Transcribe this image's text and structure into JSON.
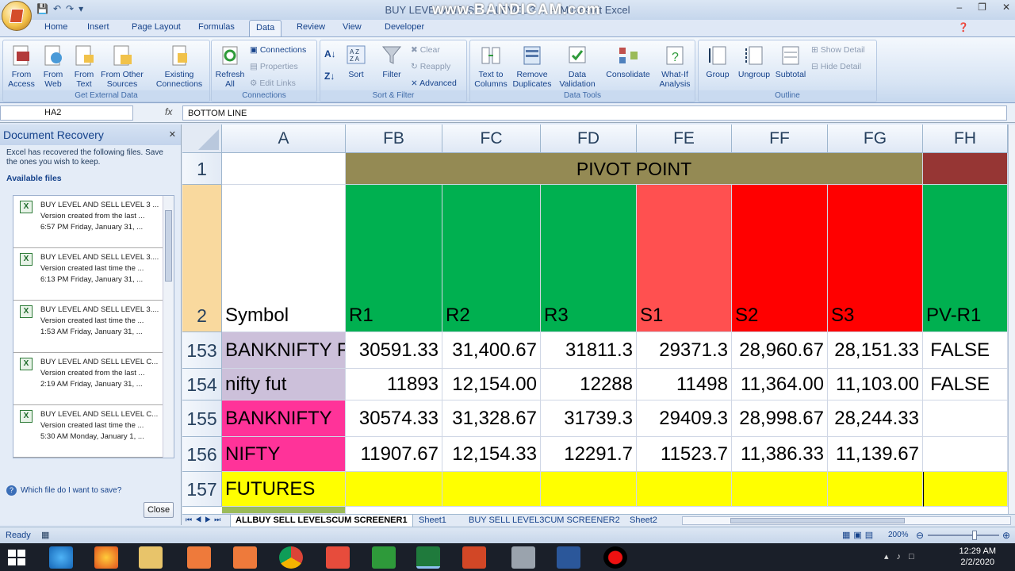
{
  "window": {
    "title": "BUY LEVEL AND SELL LEVEL 3 CUM SCREENER - Microsoft Excel",
    "title_visible": "BUY LEVEL AND SELL LEVEL 3 … – Microsoft Excel",
    "watermark": "www.BANDICAM.com"
  },
  "tabs": [
    "Home",
    "Insert",
    "Page Layout",
    "Formulas",
    "Data",
    "Review",
    "View",
    "Developer"
  ],
  "active_tab": "Data",
  "ribbon": {
    "get_external_data": {
      "label": "Get External Data",
      "buttons": [
        "From Access",
        "From Web",
        "From Text",
        "From Other Sources",
        "Existing Connections"
      ]
    },
    "connections": {
      "label": "Connections",
      "refresh": "Refresh All",
      "small": [
        "Connections",
        "Properties",
        "Edit Links"
      ]
    },
    "sort_filter": {
      "label": "Sort & Filter",
      "sort": "Sort",
      "filter": "Filter",
      "small": [
        "Clear",
        "Reapply",
        "Advanced"
      ]
    },
    "data_tools": {
      "label": "Data Tools",
      "buttons": [
        "Text to Columns",
        "Remove Duplicates",
        "Data Validation",
        "Consolidate",
        "What-If Analysis"
      ]
    },
    "outline": {
      "label": "Outline",
      "buttons": [
        "Group",
        "Ungroup",
        "Subtotal"
      ],
      "small": [
        "Show Detail",
        "Hide Detail"
      ]
    }
  },
  "formula_bar": {
    "name_box": "HA2",
    "fx": "fx",
    "formula": "BOTTOM LINE"
  },
  "recovery": {
    "title": "Document Recovery",
    "message": "Excel has recovered the following files. Save the ones you wish to keep.",
    "available_label": "Available files",
    "files": [
      {
        "name": "BUY LEVEL AND SELL LEVEL 3 ...",
        "desc": "Version created from the last ...",
        "time": "6:57 PM Friday, January 31, ..."
      },
      {
        "name": "BUY LEVEL AND SELL LEVEL 3....",
        "desc": "Version created last time the ...",
        "time": "6:13 PM Friday, January 31, ..."
      },
      {
        "name": "BUY LEVEL AND SELL LEVEL 3....",
        "desc": "Version created last time the ...",
        "time": "1:53 AM Friday, January 31, ..."
      },
      {
        "name": "BUY LEVEL AND SELL LEVEL C...",
        "desc": "Version created from the last ...",
        "time": "2:19 AM Friday, January 31, ..."
      },
      {
        "name": "BUY LEVEL AND SELL LEVEL C...",
        "desc": "Version created last time the ...",
        "time": "5:30 AM Monday, January 1, ..."
      }
    ],
    "help_link": "Which file do I want to save?",
    "close_label": "Close"
  },
  "grid": {
    "columns": [
      "A",
      "FB",
      "FC",
      "FD",
      "FE",
      "FF",
      "FG",
      "FH"
    ],
    "row1": {
      "num": "1",
      "merged": "PIVOT POINT"
    },
    "row2": {
      "num": "2",
      "cells": [
        "Symbol",
        "R1",
        "R2",
        "R3",
        "S1",
        "S2",
        "S3",
        "PV-R1"
      ]
    },
    "rows": [
      {
        "num": "153",
        "cells": [
          "BANKNIFTY FUT",
          "30591.33",
          "31,400.67",
          "31811.3",
          "29371.3",
          "28,960.67",
          "28,151.33",
          "FALSE"
        ]
      },
      {
        "num": "154",
        "cells": [
          "nifty fut",
          "11893",
          "12,154.00",
          "12288",
          "11498",
          "11,364.00",
          "11,103.00",
          "FALSE"
        ]
      },
      {
        "num": "155",
        "cells": [
          "BANKNIFTY",
          "30574.33",
          "31,328.67",
          "31739.3",
          "29409.3",
          "28,998.67",
          "28,244.33",
          ""
        ]
      },
      {
        "num": "156",
        "cells": [
          "NIFTY",
          "11907.67",
          "12,154.33",
          "12291.7",
          "11523.7",
          "11,386.33",
          "11,139.67",
          ""
        ]
      },
      {
        "num": "157",
        "cells": [
          "FUTURES",
          "",
          "",
          "",
          "",
          "",
          "",
          ""
        ]
      }
    ],
    "colors": {
      "pivot": "#948a54",
      "fh_header": "#963634",
      "green": "#00b050",
      "light_red": "#ff5050",
      "red": "#ff0000",
      "lavender": "#ccc0da",
      "pink": "#ff3399",
      "yellow": "#ffff00"
    }
  },
  "sheets": [
    "ALLBUY SELL LEVELSCUM SCREENER1",
    "Sheet1",
    "BUY SELL LEVEL3CUM SCREENER2",
    "Sheet2"
  ],
  "status": {
    "ready": "Ready",
    "zoom": "200%"
  },
  "taskbar": {
    "time": "12:29 AM",
    "date": "2/2/2020"
  }
}
